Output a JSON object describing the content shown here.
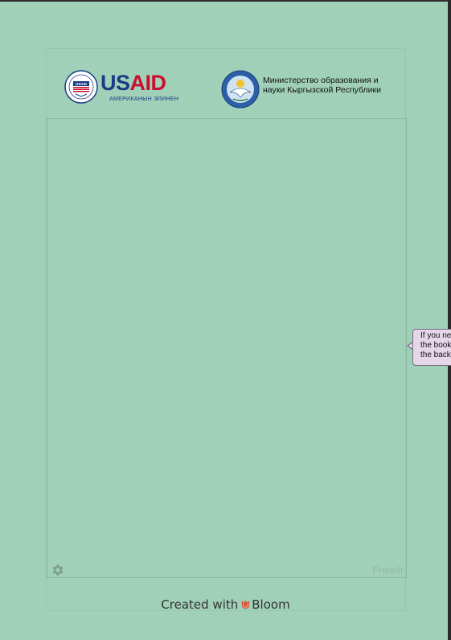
{
  "logos": {
    "usaid": {
      "word_blue": "US",
      "word_red": "AID",
      "subtitle": "АМЕРИКАНЫН ЭЛИНЕН",
      "seal_text": "USAID"
    },
    "ministry": {
      "text": "Министерство образования и науки Кыргызской Республики"
    }
  },
  "content": {
    "language_label": "French"
  },
  "bubble": {
    "lines": [
      "If you ne",
      "the book",
      "the back"
    ]
  },
  "footer": {
    "prefix": "Created with",
    "brand": "Bloom"
  },
  "colors": {
    "page_background": "#a1d0b9",
    "usaid_blue": "#1c3b85",
    "usaid_red": "#c8102e",
    "bubble_background": "#e5d7e8",
    "bloom_orange": "#d65a3a"
  },
  "icons": [
    "usaid-seal-icon",
    "ministry-seal-icon",
    "gear-icon",
    "bloom-logo-icon"
  ]
}
